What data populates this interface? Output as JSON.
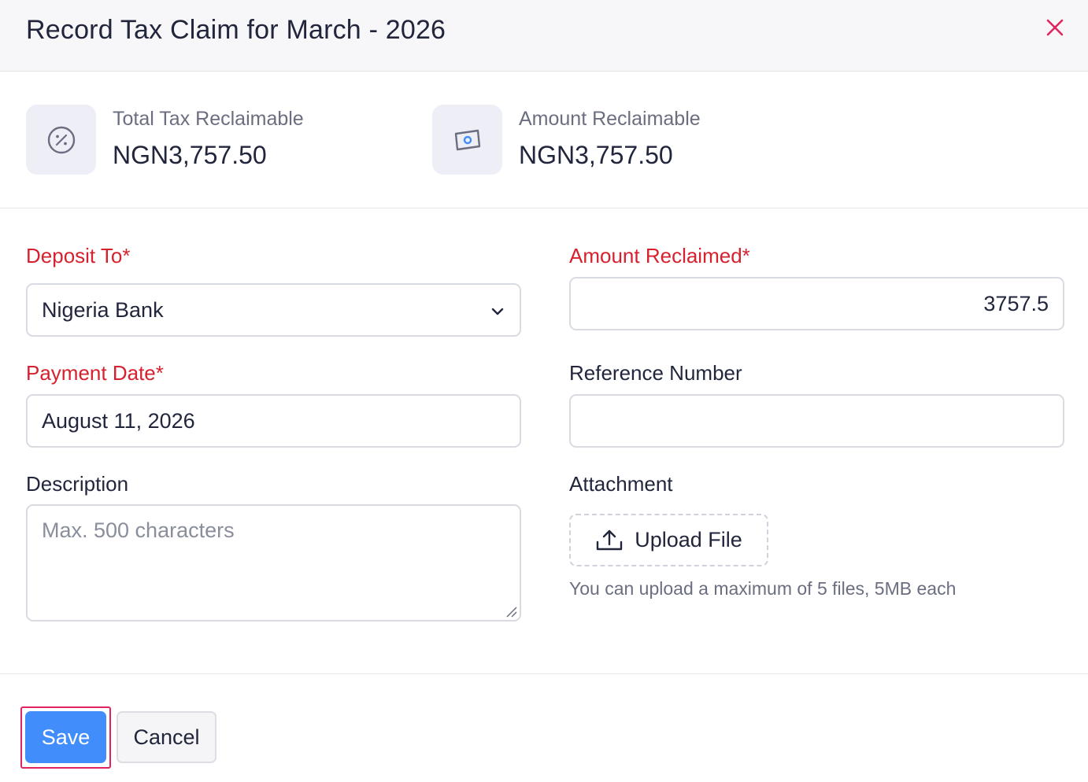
{
  "header": {
    "title": "Record Tax Claim for March - 2026",
    "close_icon": "close-icon"
  },
  "summary": {
    "total_tax": {
      "label": "Total Tax Reclaimable",
      "value": "NGN3,757.50",
      "icon": "percent-icon"
    },
    "amount": {
      "label": "Amount Reclaimable",
      "value": "NGN3,757.50",
      "icon": "money-icon"
    }
  },
  "form": {
    "deposit_to": {
      "label": "Deposit To*",
      "value": "Nigeria Bank"
    },
    "amount_reclaimed": {
      "label": "Amount Reclaimed*",
      "value": "3757.5"
    },
    "payment_date": {
      "label": "Payment Date*",
      "value": "August 11, 2026"
    },
    "reference_number": {
      "label": "Reference Number",
      "value": ""
    },
    "description": {
      "label": "Description",
      "placeholder": "Max. 500 characters"
    },
    "attachment": {
      "label": "Attachment",
      "button_label": "Upload File",
      "hint": "You can upload a maximum of 5 files, 5MB each"
    }
  },
  "footer": {
    "save_label": "Save",
    "cancel_label": "Cancel"
  },
  "colors": {
    "accent": "#408dfb",
    "required": "#d6212e",
    "close": "#e0245e",
    "focus_ring": "#e0245e"
  }
}
